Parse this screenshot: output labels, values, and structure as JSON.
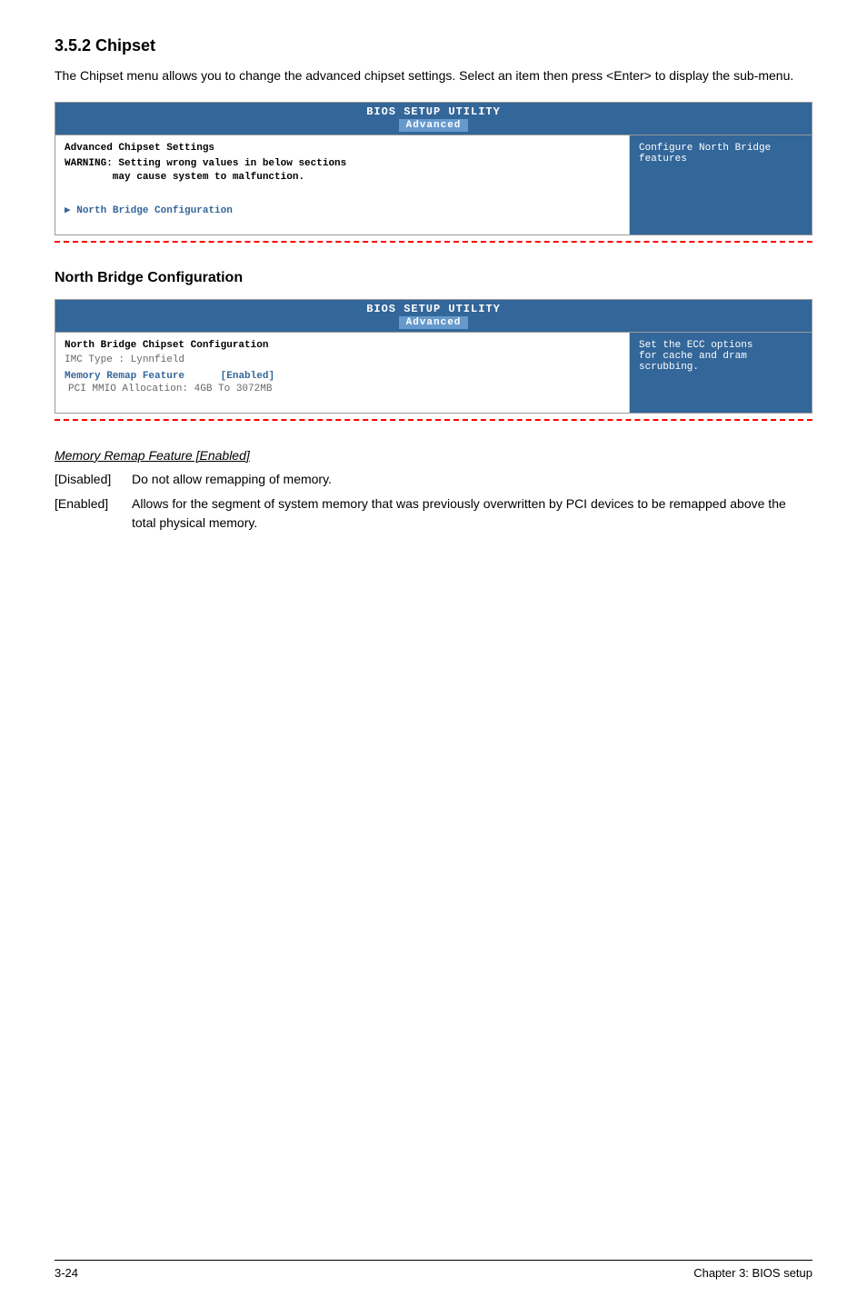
{
  "section1": {
    "title": "3.5.2    Chipset",
    "intro": "The Chipset menu allows you to change the advanced chipset settings. Select an item then press <Enter> to display the sub-menu.",
    "bios1": {
      "header_top": "BIOS SETUP UTILITY",
      "header_tab": "Advanced",
      "left": {
        "section_label": "Advanced Chipset Settings",
        "warning": "WARNING: Setting wrong values in below sections\n        may cause system to malfunction.",
        "menu_item": "North Bridge Configuration"
      },
      "right": {
        "help": "Configure North Bridge\nfeatures"
      }
    }
  },
  "section2": {
    "title": "North Bridge Configuration",
    "bios2": {
      "header_top": "BIOS SETUP UTILITY",
      "header_tab": "Advanced",
      "left": {
        "section_label": "North Bridge Chipset Configuration",
        "imc": "IMC Type : Lynnfield",
        "memory_remap_label": "Memory Remap Feature",
        "memory_remap_value": "[Enabled]",
        "pci_mmio": "PCI MMIO Allocation: 4GB To 3072MB"
      },
      "right": {
        "help": "Set the ECC options\nfor cache and dram\nscrubbing."
      }
    }
  },
  "feature_desc": {
    "title": "Memory Remap Feature [Enabled]",
    "disabled_label": "[Disabled]",
    "disabled_text": "Do not allow remapping of memory.",
    "enabled_label": "[Enabled]",
    "enabled_text": "Allows for the segment of system memory that was previously overwritten by PCI devices to be remapped above the total physical memory."
  },
  "footer": {
    "page_number": "3-24",
    "chapter": "Chapter 3: BIOS setup"
  }
}
